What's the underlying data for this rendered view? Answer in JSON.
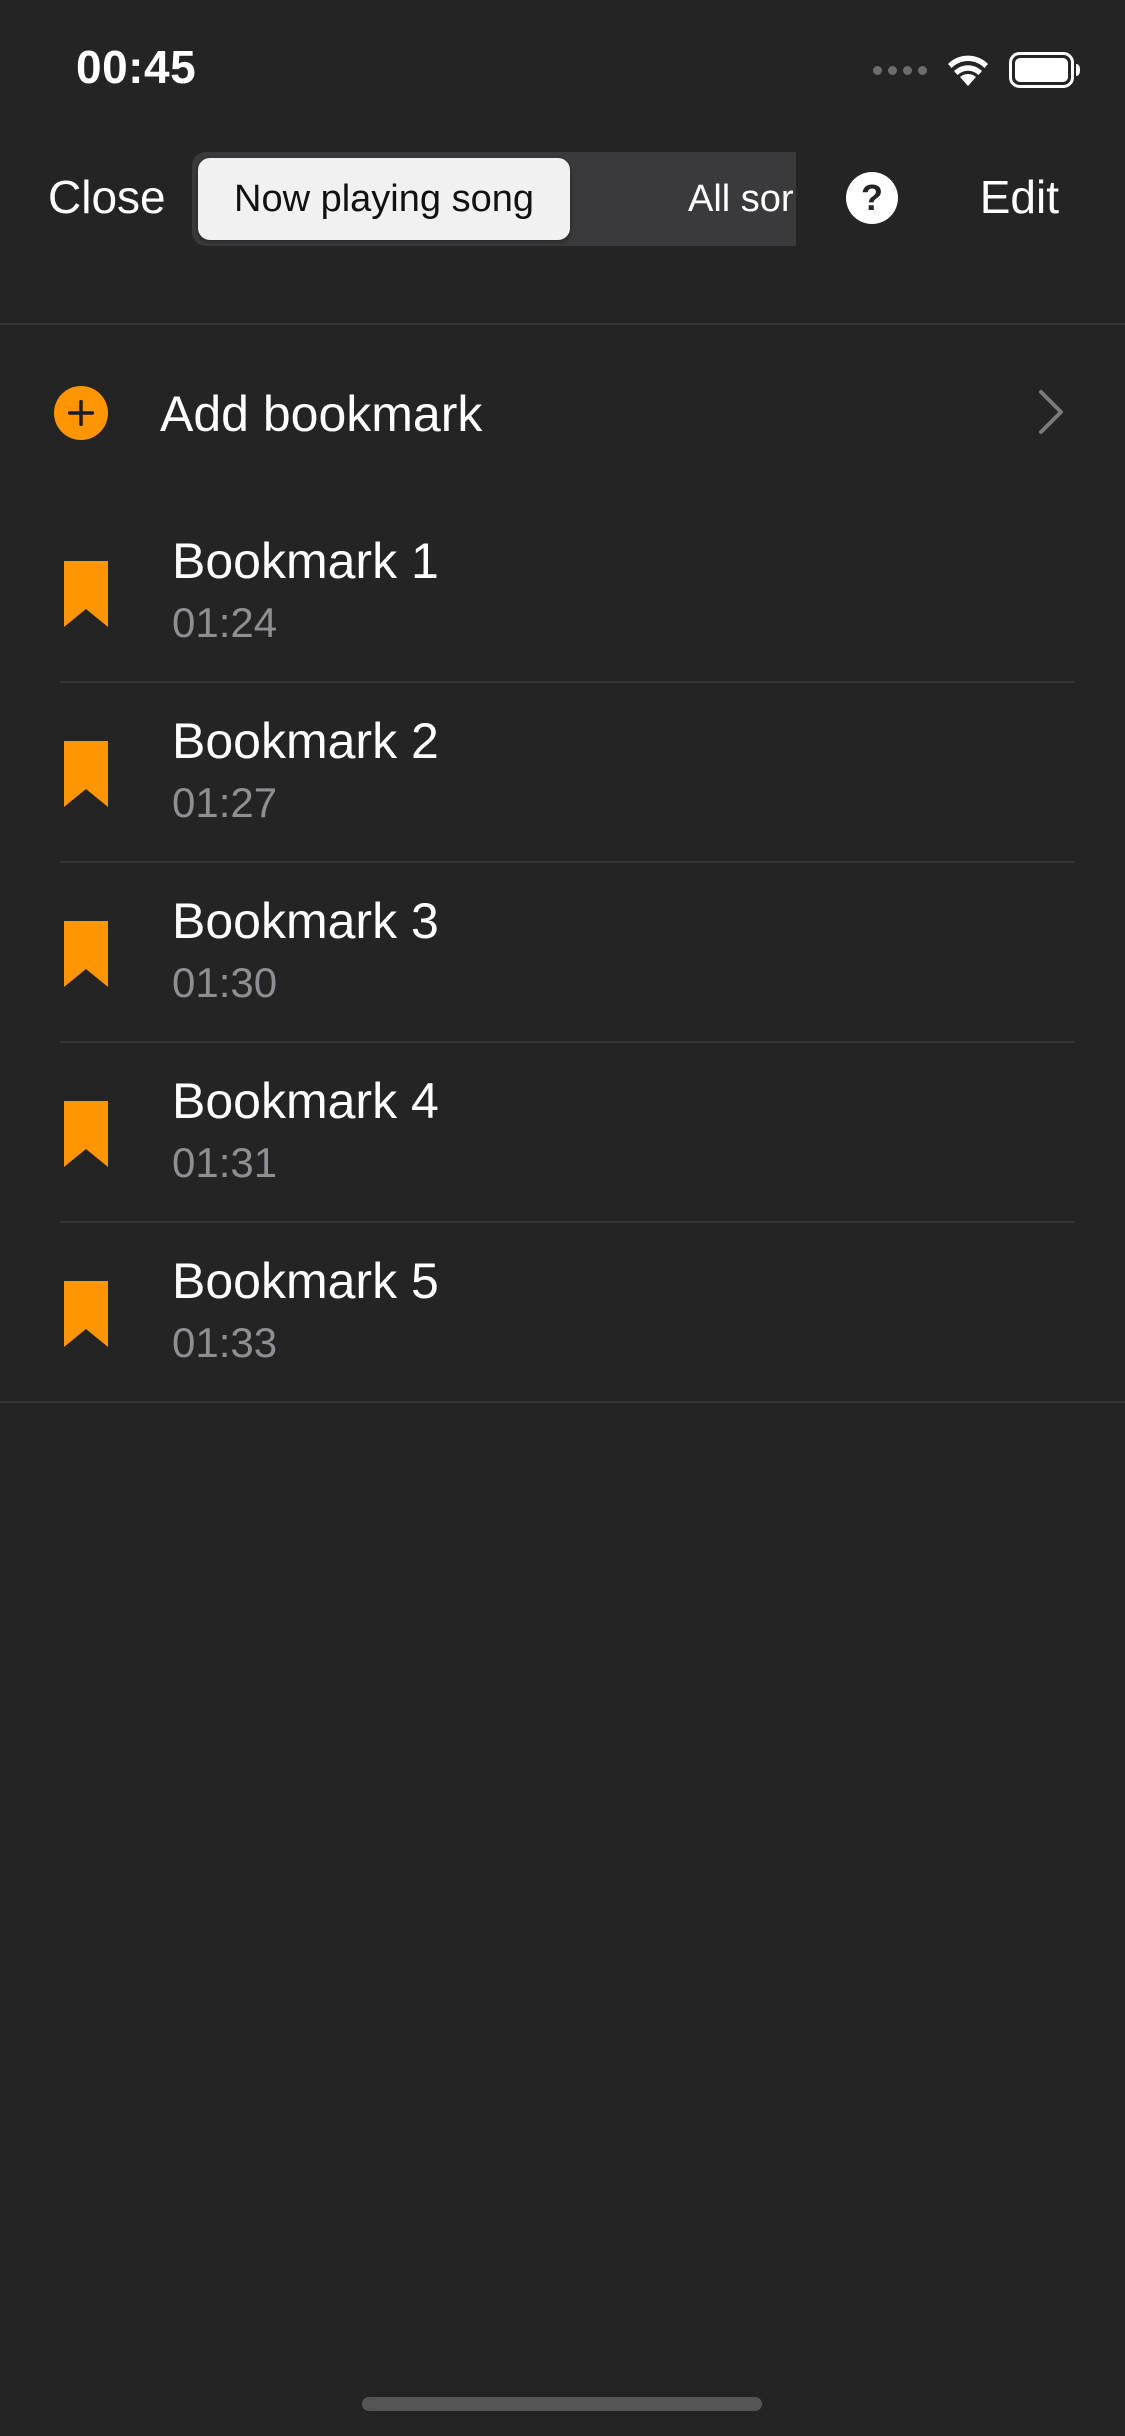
{
  "status_bar": {
    "time": "00:45",
    "icons": [
      "cellular-signal-icon",
      "wifi-icon",
      "battery-icon"
    ]
  },
  "nav": {
    "close_label": "Close",
    "segments": [
      {
        "label": "Now playing song",
        "selected": true
      },
      {
        "label": "All songs",
        "visible_text": "All sor",
        "selected": false
      }
    ],
    "help_label": "?",
    "edit_label": "Edit"
  },
  "add_bookmark": {
    "label": "Add bookmark",
    "icon": "plus-circle-icon",
    "accent_color": "#ff9500"
  },
  "bookmarks": [
    {
      "title": "Bookmark 1",
      "time": "01:24"
    },
    {
      "title": "Bookmark 2",
      "time": "01:27"
    },
    {
      "title": "Bookmark 3",
      "time": "01:30"
    },
    {
      "title": "Bookmark 4",
      "time": "01:31"
    },
    {
      "title": "Bookmark 5",
      "time": "01:33"
    }
  ],
  "colors": {
    "background": "#242424",
    "accent": "#ff9500",
    "secondary_text": "#8e8e93"
  }
}
